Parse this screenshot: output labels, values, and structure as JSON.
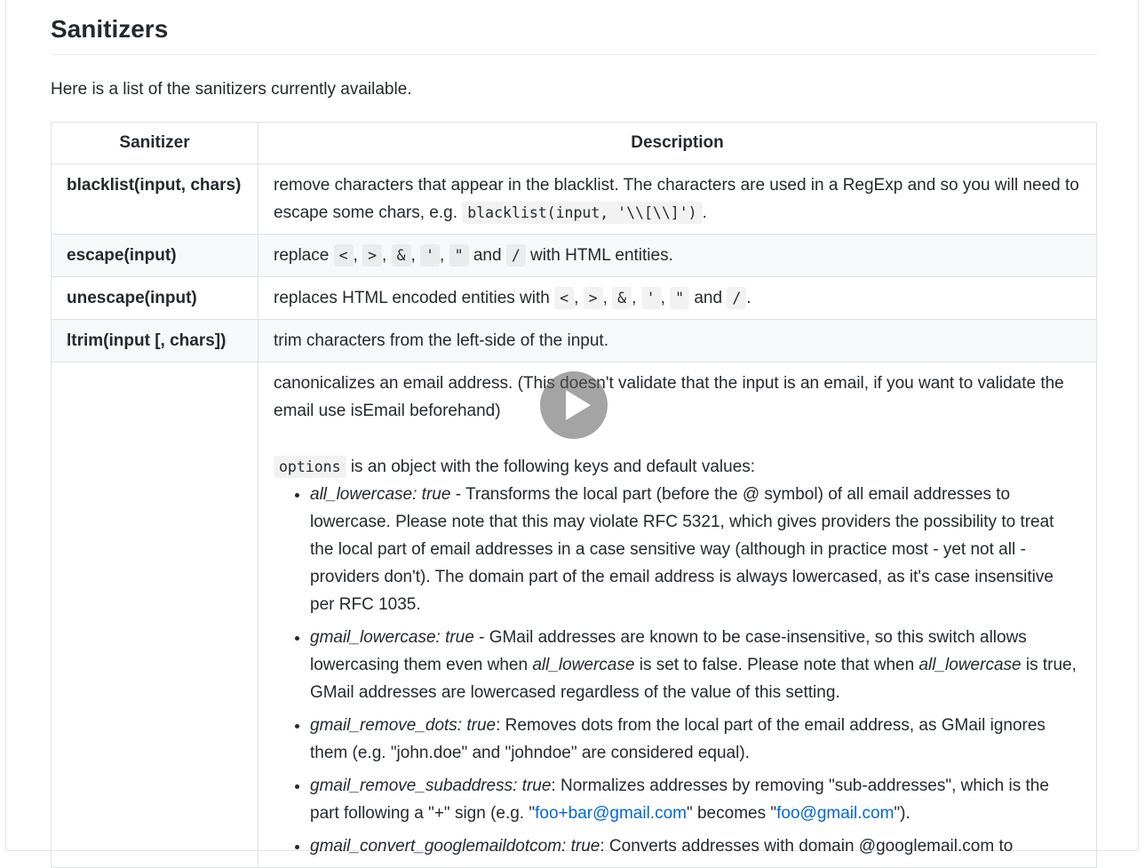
{
  "heading": "Sanitizers",
  "intro": "Here is a list of the sanitizers currently available.",
  "table": {
    "headers": [
      "Sanitizer",
      "Description"
    ],
    "rows": {
      "blacklist": {
        "name": "blacklist(input, chars)",
        "desc_before": "remove characters that appear in the blacklist. The characters are used in a RegExp and so you will need to escape some chars, e.g. ",
        "desc_code": "blacklist(input, '\\\\[\\\\]')",
        "desc_after": "."
      },
      "escape": {
        "name": "escape(input)",
        "t1": "replace ",
        "codes": [
          "<",
          ">",
          "&",
          "'",
          "\""
        ],
        "and": " and ",
        "slash": "/",
        "t2": " with HTML entities."
      },
      "unescape": {
        "name": "unescape(input)",
        "t1": "replaces HTML encoded entities with ",
        "codes": [
          "<",
          ">",
          "&",
          "'",
          "\""
        ],
        "and": " and ",
        "slash": "/",
        "t2": "."
      },
      "ltrim": {
        "name": "ltrim(input [, chars])",
        "desc": "trim characters from the left-side of the input."
      },
      "normalize": {
        "name": "",
        "p1": "canonicalizes an email address. (This doesn't validate that the input is an email, if you want to validate the email use isEmail beforehand)",
        "options_code": "options",
        "p2": " is an object with the following keys and default values:",
        "items": [
          {
            "key": "all_lowercase: true",
            "text": " - Transforms the local part (before the @ symbol) of all email addresses to lowercase. Please note that this may violate RFC 5321, which gives providers the possibility to treat the local part of email addresses in a case sensitive way (although in practice most - yet not all - providers don't). The domain part of the email address is always lowercased, as it's case insensitive per RFC 1035."
          },
          {
            "key": "gmail_lowercase: true",
            "text_a": " - GMail addresses are known to be case-insensitive, so this switch allows lowercasing them even when ",
            "em1": "all_lowercase",
            "text_b": " is set to false. Please note that when ",
            "em2": "all_lowercase",
            "text_c": " is true, GMail addresses are lowercased regardless of the value of this setting."
          },
          {
            "key": "gmail_remove_dots: true",
            "text": ": Removes dots from the local part of the email address, as GMail ignores them (e.g. \"john.doe\" and \"johndoe\" are considered equal)."
          },
          {
            "key": "gmail_remove_subaddress: true",
            "text_a": ": Normalizes addresses by removing \"sub-addresses\", which is the part following a \"+\" sign (e.g. \"",
            "link1": "foo+bar@gmail.com",
            "text_b": "\" becomes \"",
            "link2": "foo@gmail.com",
            "text_c": "\")."
          },
          {
            "key": "gmail_convert_googlemaildotcom: true",
            "text": ": Converts addresses with domain @googlemail.com to"
          }
        ]
      }
    }
  },
  "video": {
    "play_icon": "play-icon"
  },
  "colors": {
    "link": "#0366d6",
    "border": "#dfe2e5",
    "alt_row": "#f6f8fa"
  }
}
